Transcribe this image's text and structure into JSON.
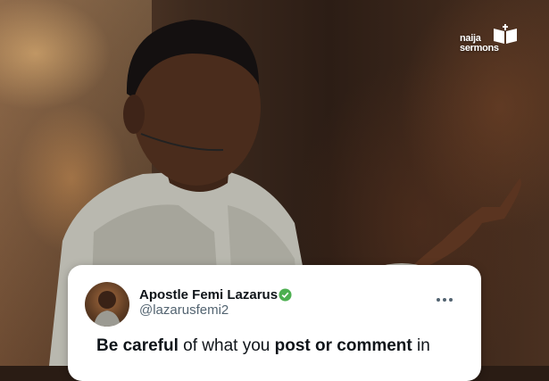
{
  "logo": {
    "line1": "naija",
    "line2": "sermons"
  },
  "tweet": {
    "author_name": "Apostle Femi Lazarus",
    "handle": "@lazarusfemi2",
    "verified_color": "#4caf50",
    "more_icon": "more-horizontal-icon",
    "text_segments": [
      {
        "text": "Be careful",
        "bold": true
      },
      {
        "text": " of what you ",
        "bold": false
      },
      {
        "text": "post or comment",
        "bold": true
      },
      {
        "text": " in",
        "bold": false
      }
    ]
  }
}
